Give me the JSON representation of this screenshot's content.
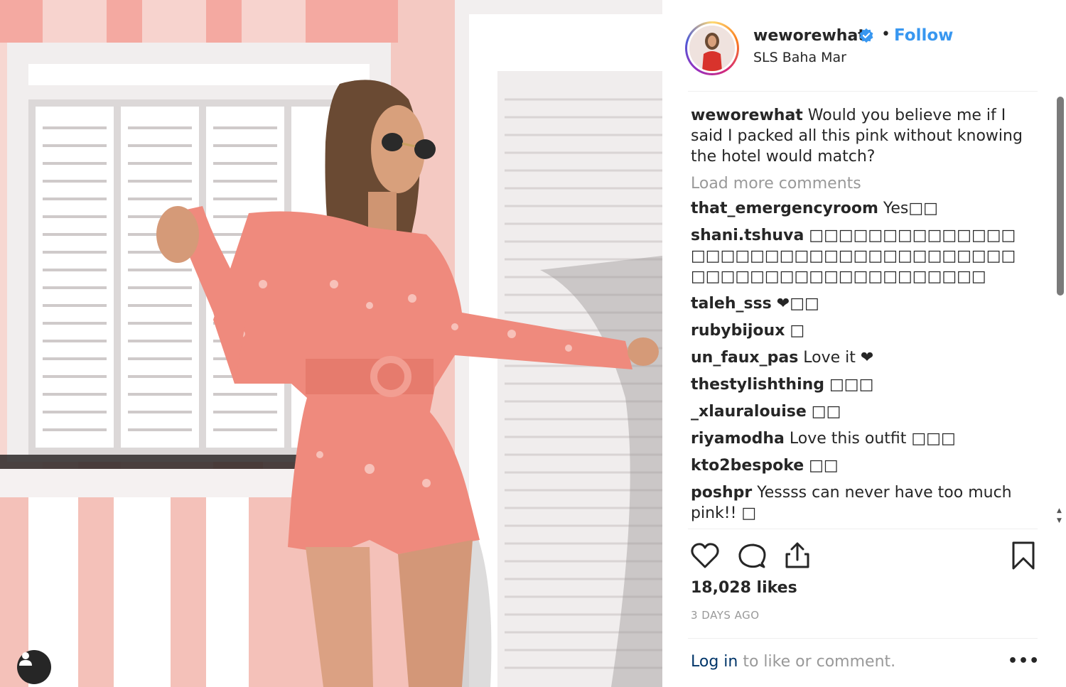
{
  "post": {
    "username": "weworewhat",
    "follow_label": "Follow",
    "dot": "•",
    "location": "SLS Baha Mar"
  },
  "caption": {
    "username": "weworewhat",
    "text": " Would you believe me if I said I packed all this pink without knowing the hotel would match?"
  },
  "load_more_label": "Load more comments",
  "comments": [
    {
      "username": "that_emergencyroom",
      "text": " Yes□□"
    },
    {
      "username": "shani.tshuva",
      "text": " □□□□□□□□□□□□□□□□□□□□□□□□□□□□□□□□□□□□□□□□□□□□□□□□□□□□□□□□"
    },
    {
      "username": "taleh_sss",
      "text": " ❤□□"
    },
    {
      "username": "rubybijoux",
      "text": " □"
    },
    {
      "username": "un_faux_pas",
      "text": " Love it ❤"
    },
    {
      "username": "thestylishthing",
      "text": " □□□"
    },
    {
      "username": "_xlauralouise",
      "text": " □□"
    },
    {
      "username": "riyamodha",
      "text": " Love this outfit □□□"
    },
    {
      "username": "kto2bespoke",
      "text": " □□"
    },
    {
      "username": "poshpr",
      "text": " Yessss can never have too much pink!! □"
    }
  ],
  "actions": {
    "like_icon": "heart-icon",
    "comment_icon": "comment-icon",
    "share_icon": "share-icon",
    "save_icon": "bookmark-icon"
  },
  "likes_label": "18,028 likes",
  "date_label": "3 DAYS AGO",
  "footer": {
    "login_link": "Log in",
    "login_rest": " to like or comment.",
    "more_label": "•••"
  },
  "colors": {
    "link_blue": "#3897f0",
    "login_blue": "#003569",
    "muted": "#999999",
    "text": "#262626"
  }
}
